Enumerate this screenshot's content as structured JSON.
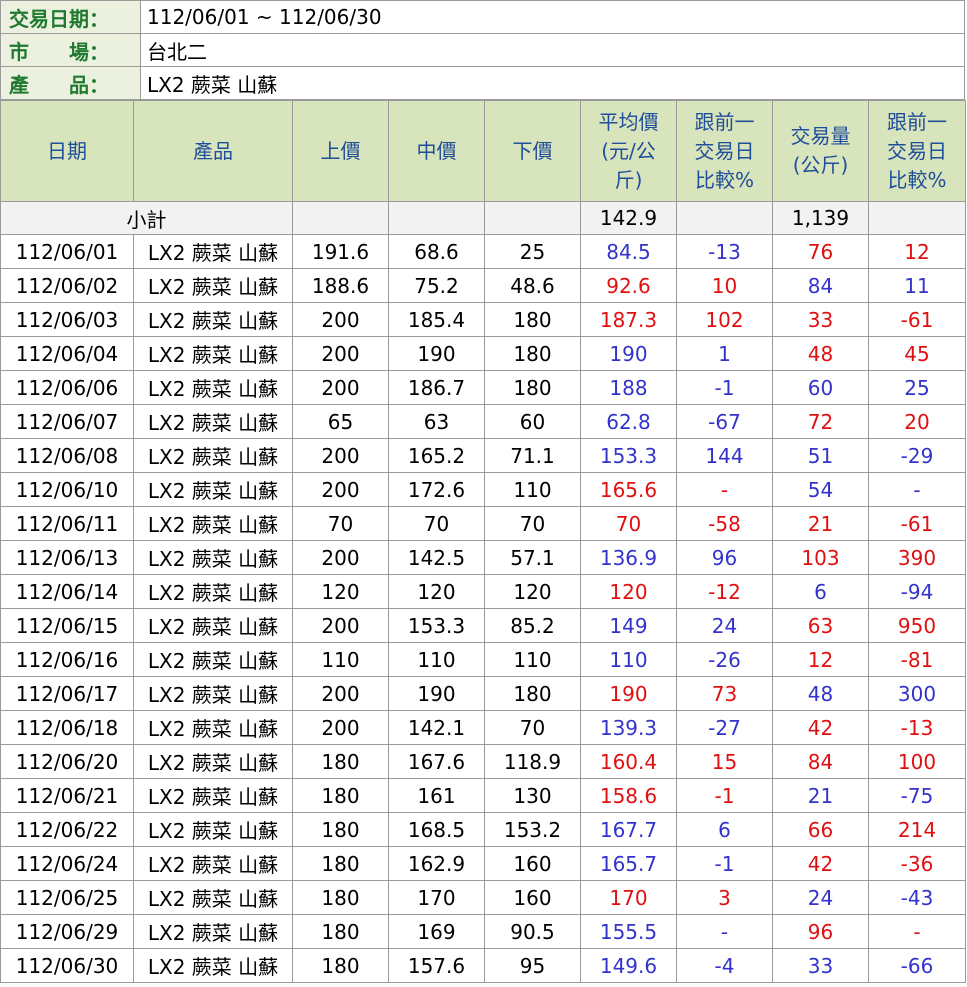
{
  "info": {
    "date_label": "交易日期：",
    "date_value": "112/06/01 ~ 112/06/30",
    "market_label": "市　　場：",
    "market_value": "台北二",
    "product_label": "產　　品：",
    "product_value": "LX2 蕨菜 山蘇"
  },
  "headers": [
    "日期",
    "產品",
    "上價",
    "中價",
    "下價",
    "平均價(元/公斤)",
    "跟前一交易日比較%",
    "交易量(公斤)",
    "跟前一交易日比較%"
  ],
  "header_lines": [
    [
      "日期"
    ],
    [
      "產品"
    ],
    [
      "上價"
    ],
    [
      "中價"
    ],
    [
      "下價"
    ],
    [
      "平均價",
      "(元/公",
      "斤)"
    ],
    [
      "跟前一",
      "交易日",
      "比較%"
    ],
    [
      "交易量",
      "(公斤)"
    ],
    [
      "跟前一",
      "交易日",
      "比較%"
    ]
  ],
  "subtotal": {
    "label": "小計",
    "avg": "142.9",
    "volume": "1,139"
  },
  "colors": {
    "up": "#e01010",
    "down": "#3333cc",
    "header_bg": "#d8e4bc",
    "label_bg": "#ebf1de"
  },
  "rows": [
    {
      "date": "112/06/01",
      "product": "LX2 蕨菜 山蘇",
      "high": "191.6",
      "mid": "68.6",
      "low": "25",
      "avg": "84.5",
      "avg_c": "b",
      "avg_chg": "-13",
      "avg_chg_c": "b",
      "vol": "76",
      "vol_c": "r",
      "vol_chg": "12",
      "vol_chg_c": "r"
    },
    {
      "date": "112/06/02",
      "product": "LX2 蕨菜 山蘇",
      "high": "188.6",
      "mid": "75.2",
      "low": "48.6",
      "avg": "92.6",
      "avg_c": "r",
      "avg_chg": "10",
      "avg_chg_c": "r",
      "vol": "84",
      "vol_c": "b",
      "vol_chg": "11",
      "vol_chg_c": "b"
    },
    {
      "date": "112/06/03",
      "product": "LX2 蕨菜 山蘇",
      "high": "200",
      "mid": "185.4",
      "low": "180",
      "avg": "187.3",
      "avg_c": "r",
      "avg_chg": "102",
      "avg_chg_c": "r",
      "vol": "33",
      "vol_c": "r",
      "vol_chg": "-61",
      "vol_chg_c": "r"
    },
    {
      "date": "112/06/04",
      "product": "LX2 蕨菜 山蘇",
      "high": "200",
      "mid": "190",
      "low": "180",
      "avg": "190",
      "avg_c": "b",
      "avg_chg": "1",
      "avg_chg_c": "b",
      "vol": "48",
      "vol_c": "r",
      "vol_chg": "45",
      "vol_chg_c": "r"
    },
    {
      "date": "112/06/06",
      "product": "LX2 蕨菜 山蘇",
      "high": "200",
      "mid": "186.7",
      "low": "180",
      "avg": "188",
      "avg_c": "b",
      "avg_chg": "-1",
      "avg_chg_c": "b",
      "vol": "60",
      "vol_c": "b",
      "vol_chg": "25",
      "vol_chg_c": "b"
    },
    {
      "date": "112/06/07",
      "product": "LX2 蕨菜 山蘇",
      "high": "65",
      "mid": "63",
      "low": "60",
      "avg": "62.8",
      "avg_c": "b",
      "avg_chg": "-67",
      "avg_chg_c": "b",
      "vol": "72",
      "vol_c": "r",
      "vol_chg": "20",
      "vol_chg_c": "r"
    },
    {
      "date": "112/06/08",
      "product": "LX2 蕨菜 山蘇",
      "high": "200",
      "mid": "165.2",
      "low": "71.1",
      "avg": "153.3",
      "avg_c": "b",
      "avg_chg": "144",
      "avg_chg_c": "b",
      "vol": "51",
      "vol_c": "b",
      "vol_chg": "-29",
      "vol_chg_c": "b"
    },
    {
      "date": "112/06/10",
      "product": "LX2 蕨菜 山蘇",
      "high": "200",
      "mid": "172.6",
      "low": "110",
      "avg": "165.6",
      "avg_c": "r",
      "avg_chg": "-",
      "avg_chg_c": "r",
      "vol": "54",
      "vol_c": "b",
      "vol_chg": "-",
      "vol_chg_c": "b"
    },
    {
      "date": "112/06/11",
      "product": "LX2 蕨菜 山蘇",
      "high": "70",
      "mid": "70",
      "low": "70",
      "avg": "70",
      "avg_c": "r",
      "avg_chg": "-58",
      "avg_chg_c": "r",
      "vol": "21",
      "vol_c": "r",
      "vol_chg": "-61",
      "vol_chg_c": "r"
    },
    {
      "date": "112/06/13",
      "product": "LX2 蕨菜 山蘇",
      "high": "200",
      "mid": "142.5",
      "low": "57.1",
      "avg": "136.9",
      "avg_c": "b",
      "avg_chg": "96",
      "avg_chg_c": "b",
      "vol": "103",
      "vol_c": "r",
      "vol_chg": "390",
      "vol_chg_c": "r"
    },
    {
      "date": "112/06/14",
      "product": "LX2 蕨菜 山蘇",
      "high": "120",
      "mid": "120",
      "low": "120",
      "avg": "120",
      "avg_c": "r",
      "avg_chg": "-12",
      "avg_chg_c": "r",
      "vol": "6",
      "vol_c": "b",
      "vol_chg": "-94",
      "vol_chg_c": "b"
    },
    {
      "date": "112/06/15",
      "product": "LX2 蕨菜 山蘇",
      "high": "200",
      "mid": "153.3",
      "low": "85.2",
      "avg": "149",
      "avg_c": "b",
      "avg_chg": "24",
      "avg_chg_c": "b",
      "vol": "63",
      "vol_c": "r",
      "vol_chg": "950",
      "vol_chg_c": "r"
    },
    {
      "date": "112/06/16",
      "product": "LX2 蕨菜 山蘇",
      "high": "110",
      "mid": "110",
      "low": "110",
      "avg": "110",
      "avg_c": "b",
      "avg_chg": "-26",
      "avg_chg_c": "b",
      "vol": "12",
      "vol_c": "r",
      "vol_chg": "-81",
      "vol_chg_c": "r"
    },
    {
      "date": "112/06/17",
      "product": "LX2 蕨菜 山蘇",
      "high": "200",
      "mid": "190",
      "low": "180",
      "avg": "190",
      "avg_c": "r",
      "avg_chg": "73",
      "avg_chg_c": "r",
      "vol": "48",
      "vol_c": "b",
      "vol_chg": "300",
      "vol_chg_c": "b"
    },
    {
      "date": "112/06/18",
      "product": "LX2 蕨菜 山蘇",
      "high": "200",
      "mid": "142.1",
      "low": "70",
      "avg": "139.3",
      "avg_c": "b",
      "avg_chg": "-27",
      "avg_chg_c": "b",
      "vol": "42",
      "vol_c": "r",
      "vol_chg": "-13",
      "vol_chg_c": "r"
    },
    {
      "date": "112/06/20",
      "product": "LX2 蕨菜 山蘇",
      "high": "180",
      "mid": "167.6",
      "low": "118.9",
      "avg": "160.4",
      "avg_c": "r",
      "avg_chg": "15",
      "avg_chg_c": "r",
      "vol": "84",
      "vol_c": "r",
      "vol_chg": "100",
      "vol_chg_c": "r"
    },
    {
      "date": "112/06/21",
      "product": "LX2 蕨菜 山蘇",
      "high": "180",
      "mid": "161",
      "low": "130",
      "avg": "158.6",
      "avg_c": "r",
      "avg_chg": "-1",
      "avg_chg_c": "r",
      "vol": "21",
      "vol_c": "b",
      "vol_chg": "-75",
      "vol_chg_c": "b"
    },
    {
      "date": "112/06/22",
      "product": "LX2 蕨菜 山蘇",
      "high": "180",
      "mid": "168.5",
      "low": "153.2",
      "avg": "167.7",
      "avg_c": "b",
      "avg_chg": "6",
      "avg_chg_c": "b",
      "vol": "66",
      "vol_c": "r",
      "vol_chg": "214",
      "vol_chg_c": "r"
    },
    {
      "date": "112/06/24",
      "product": "LX2 蕨菜 山蘇",
      "high": "180",
      "mid": "162.9",
      "low": "160",
      "avg": "165.7",
      "avg_c": "b",
      "avg_chg": "-1",
      "avg_chg_c": "b",
      "vol": "42",
      "vol_c": "r",
      "vol_chg": "-36",
      "vol_chg_c": "r"
    },
    {
      "date": "112/06/25",
      "product": "LX2 蕨菜 山蘇",
      "high": "180",
      "mid": "170",
      "low": "160",
      "avg": "170",
      "avg_c": "r",
      "avg_chg": "3",
      "avg_chg_c": "r",
      "vol": "24",
      "vol_c": "b",
      "vol_chg": "-43",
      "vol_chg_c": "b"
    },
    {
      "date": "112/06/29",
      "product": "LX2 蕨菜 山蘇",
      "high": "180",
      "mid": "169",
      "low": "90.5",
      "avg": "155.5",
      "avg_c": "b",
      "avg_chg": "-",
      "avg_chg_c": "b",
      "vol": "96",
      "vol_c": "r",
      "vol_chg": "-",
      "vol_chg_c": "r"
    },
    {
      "date": "112/06/30",
      "product": "LX2 蕨菜 山蘇",
      "high": "180",
      "mid": "157.6",
      "low": "95",
      "avg": "149.6",
      "avg_c": "b",
      "avg_chg": "-4",
      "avg_chg_c": "b",
      "vol": "33",
      "vol_c": "b",
      "vol_chg": "-66",
      "vol_chg_c": "b"
    }
  ]
}
